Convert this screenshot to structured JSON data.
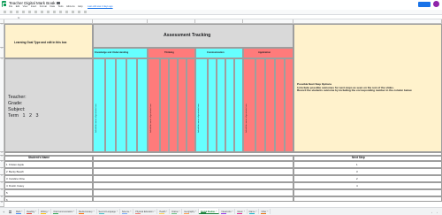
{
  "app": {
    "title": "Teacher Digital Mark Book",
    "menus": [
      "File",
      "Edit",
      "View",
      "Insert",
      "Format",
      "Data",
      "Tools",
      "Add-ons",
      "Help"
    ],
    "last_edit": "Last edit was 2 days ago",
    "fx": "fx"
  },
  "sheet": {
    "goal_label": "Learning Goal Type and edit in this box",
    "assessment_title": "Assessment Tracking",
    "categories": [
      "Knowledge and Understanding",
      "Thinking",
      "Communication",
      "Application"
    ],
    "teacher_lines": [
      "Teacher:",
      "Grade:",
      "Subject:",
      "Term   1   2   3"
    ],
    "vertical_label": "Include the names of your tasks here",
    "next_step_text": "Possible Next Step Options\n1) Include possible outcomes for next steps as seen on the rest of the slides.\nRecord the students outcome by including the corresponding number in the column below.",
    "students_header": "Student's Name",
    "next_step_header": "Next Step",
    "students": [
      {
        "num": "1",
        "name": "Kristen Apple",
        "next": "1"
      },
      {
        "num": "2",
        "name": "Becky Beach",
        "next": "3"
      },
      {
        "num": "3",
        "name": "Candice Cline",
        "next": "2"
      },
      {
        "num": "4",
        "name": "Dustin Casey",
        "next": "4"
      },
      {
        "num": "5",
        "name": "",
        "next": ""
      },
      {
        "num": "6",
        "name": "",
        "next": ""
      }
    ],
    "row_numbers": [
      "1",
      "2",
      "3",
      "4",
      "5",
      "6",
      "7",
      "8",
      "9",
      "10",
      "11",
      "12"
    ]
  },
  "tabs": [
    {
      "label": "Math",
      "color": "#4285f4",
      "active": false
    },
    {
      "label": "Reading",
      "color": "#ea4335",
      "active": false
    },
    {
      "label": "Writing",
      "color": "#fbbc04",
      "active": false
    },
    {
      "label": "Oral Communication",
      "color": "#34a853",
      "active": false
    },
    {
      "label": "Media Literacy",
      "color": "#ff6d01",
      "active": false
    },
    {
      "label": "Second Language",
      "color": "#46bdc6",
      "active": false
    },
    {
      "label": "Science",
      "color": "#7baaf7",
      "active": false
    },
    {
      "label": "Physical Education",
      "color": "#f07b72",
      "active": false
    },
    {
      "label": "Health",
      "color": "#fcd04f",
      "active": false
    },
    {
      "label": "Drama",
      "color": "#71c287",
      "active": false
    },
    {
      "label": "Geography",
      "color": "#ff994d",
      "active": false
    },
    {
      "label": "Social Studies",
      "color": "#188038",
      "active": true
    },
    {
      "label": "Visual Arts",
      "color": "#9334e6",
      "active": false
    },
    {
      "label": "Music",
      "color": "#e52592",
      "active": false
    },
    {
      "label": "Dance",
      "color": "#12b5cb",
      "active": false
    },
    {
      "label": "Other",
      "color": "#e8710a",
      "active": false
    }
  ],
  "colors": {
    "yellow": "#fff2cc",
    "grey": "#d9d9d9",
    "cyan": "#66ffff",
    "red": "#ff7b7b",
    "active_tab": "#188038"
  }
}
